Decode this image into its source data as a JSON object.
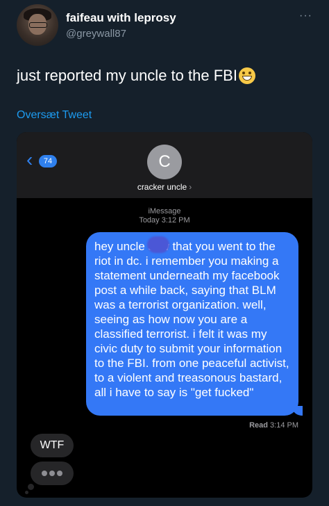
{
  "tweet": {
    "display_name": "faifeau with leprosy",
    "handle": "@greywall87",
    "more_label": "···",
    "text": "just reported my uncle to the FBI",
    "translate_label": "Oversæt Tweet"
  },
  "imessage": {
    "back_count": "74",
    "contact_initial": "C",
    "contact_name": "cracker uncle",
    "service": "iMessage",
    "timestamp": "Today 3:12 PM",
    "outgoing_message": "hey uncle        saw that you went to the riot in dc. i remember you making a statement underneath my facebook post a while back, saying that BLM was a terrorist organization. well, seeing as how now you are a classified terrorist. i felt it was my civic duty to submit your information to the FBI. from one peaceful activist, to a violent and treasonous bastard, all i have to say is \"get fucked\"",
    "read_label": "Read",
    "read_time": "3:14 PM",
    "incoming_message": "WTF"
  },
  "colors": {
    "background": "#15202b",
    "link": "#1d9bf0",
    "imessage_blue": "#3478f6",
    "incoming_bubble": "#262628"
  }
}
